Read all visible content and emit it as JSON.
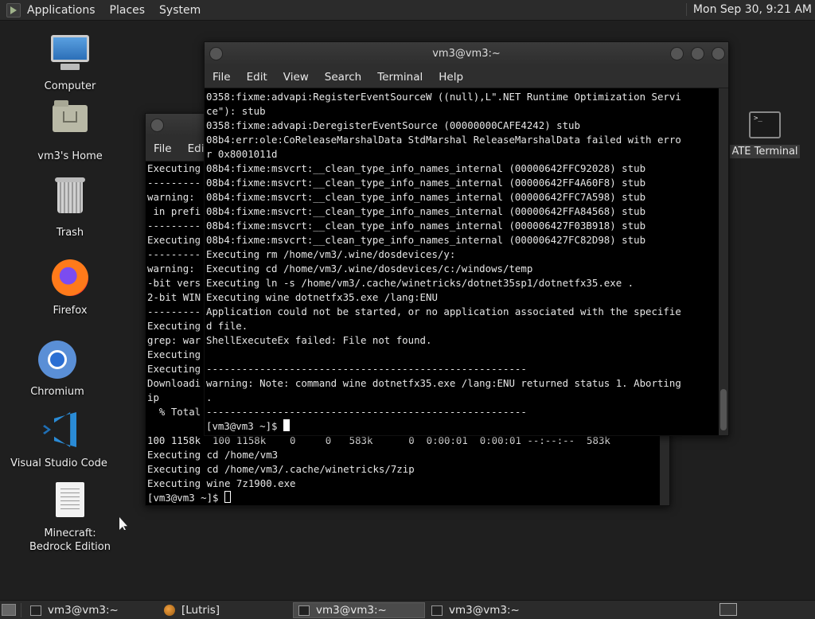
{
  "top_panel": {
    "menu": [
      "Applications",
      "Places",
      "System"
    ],
    "clock": "Mon Sep 30, 9:21 AM"
  },
  "desktop_icons": [
    {
      "label": "Computer",
      "icon": "computer-icon"
    },
    {
      "label": "vm3's Home",
      "icon": "home-folder-icon"
    },
    {
      "label": "Trash",
      "icon": "trash-icon"
    },
    {
      "label": "Firefox",
      "icon": "firefox-icon"
    },
    {
      "label": "Chromium",
      "icon": "chromium-icon"
    },
    {
      "label": "Visual Studio Code",
      "icon": "vscode-icon"
    },
    {
      "label": "Minecraft: Bedrock Edition",
      "icon": "document-icon"
    }
  ],
  "floating_icon": {
    "label": "ATE Terminal",
    "icon": "terminal-icon"
  },
  "front_terminal": {
    "title": "vm3@vm3:~",
    "menu": [
      "File",
      "Edit",
      "View",
      "Search",
      "Terminal",
      "Help"
    ],
    "lines": [
      "0358:fixme:advapi:RegisterEventSourceW ((null),L\".NET Runtime Optimization Servi",
      "ce\"): stub",
      "0358:fixme:advapi:DeregisterEventSource (00000000CAFE4242) stub",
      "08b4:err:ole:CoReleaseMarshalData StdMarshal ReleaseMarshalData failed with erro",
      "r 0x8001011d",
      "08b4:fixme:msvcrt:__clean_type_info_names_internal (00000642FFC92028) stub",
      "08b4:fixme:msvcrt:__clean_type_info_names_internal (00000642FF4A60F8) stub",
      "08b4:fixme:msvcrt:__clean_type_info_names_internal (00000642FFC7A598) stub",
      "08b4:fixme:msvcrt:__clean_type_info_names_internal (00000642FFA84568) stub",
      "08b4:fixme:msvcrt:__clean_type_info_names_internal (000006427F03B918) stub",
      "08b4:fixme:msvcrt:__clean_type_info_names_internal (000006427FC82D98) stub",
      "Executing rm /home/vm3/.wine/dosdevices/y:",
      "Executing cd /home/vm3/.wine/dosdevices/c:/windows/temp",
      "Executing ln -s /home/vm3/.cache/winetricks/dotnet35sp1/dotnetfx35.exe .",
      "Executing wine dotnetfx35.exe /lang:ENU",
      "Application could not be started, or no application associated with the specifie",
      "d file.",
      "ShellExecuteEx failed: File not found.",
      "",
      "------------------------------------------------------",
      "warning: Note: command wine dotnetfx35.exe /lang:ENU returned status 1. Aborting",
      ".",
      "------------------------------------------------------"
    ],
    "prompt": "[vm3@vm3 ~]$ "
  },
  "back_terminal": {
    "menu": [
      "File",
      "Edi"
    ],
    "lines": [
      "Executing",
      "---------",
      "warning:",
      " in prefi",
      "---------",
      "Executing",
      "---------",
      "warning:",
      "-bit vers",
      "2-bit WIN",
      "---------",
      "Executing",
      "grep: war",
      "Executing",
      "Executing",
      "Downloadi",
      "ip",
      "  % Total",
      "",
      "100 1158k  100 1158k    0     0   583k      0  0:00:01  0:00:01 --:--:--  583k",
      "Executing cd /home/vm3",
      "Executing cd /home/vm3/.cache/winetricks/7zip",
      "Executing wine 7z1900.exe"
    ],
    "prompt": "[vm3@vm3 ~]$ "
  },
  "taskbar": {
    "items": [
      {
        "label": "vm3@vm3:~",
        "icon": "terminal-icon",
        "active": false
      },
      {
        "label": "[Lutris]",
        "icon": "lutris-icon",
        "active": false
      },
      {
        "label": "vm3@vm3:~",
        "icon": "terminal-icon",
        "active": true
      },
      {
        "label": "vm3@vm3:~",
        "icon": "terminal-icon",
        "active": false
      }
    ]
  }
}
